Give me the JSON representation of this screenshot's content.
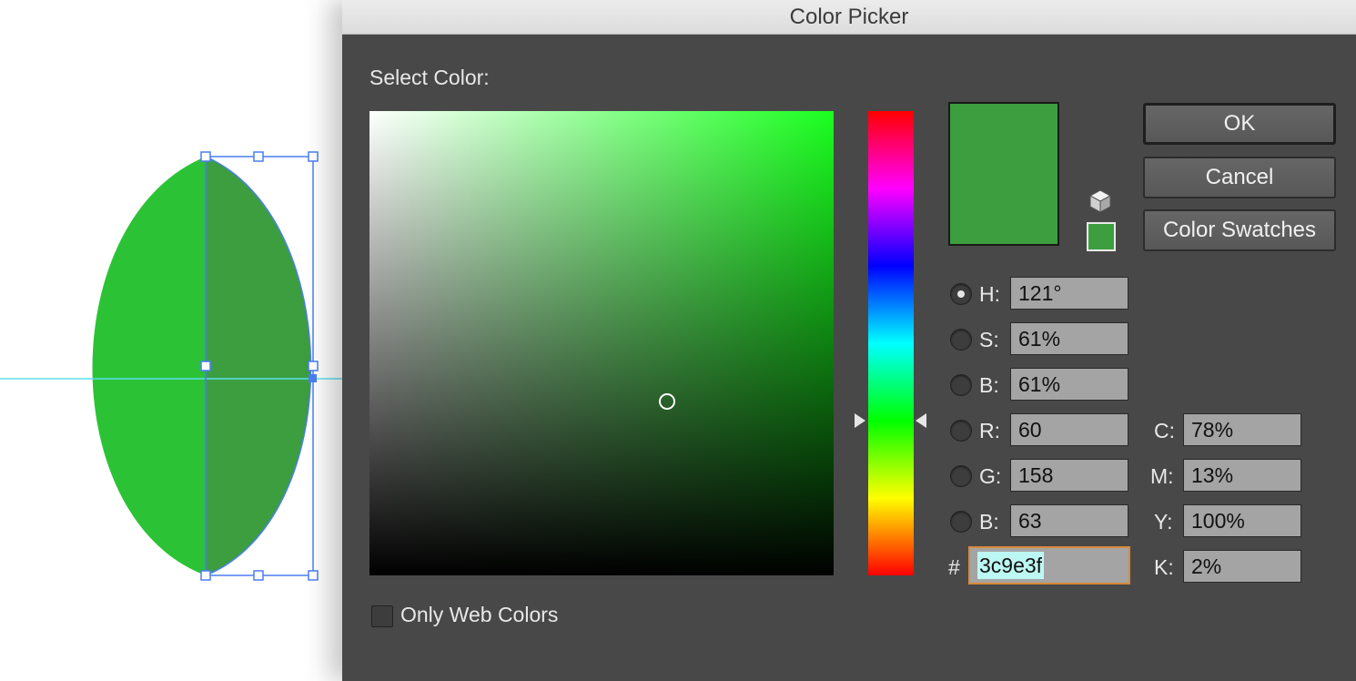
{
  "window": {
    "title": "Color Picker"
  },
  "select_label": "Select Color:",
  "current_color": "#3c9e3f",
  "fill_color_left": "#2bc335",
  "buttons": {
    "ok": "OK",
    "cancel": "Cancel",
    "swatches": "Color Swatches"
  },
  "hsb": [
    {
      "label": "H:",
      "value": "121°",
      "selected": true
    },
    {
      "label": "S:",
      "value": "61%",
      "selected": false
    },
    {
      "label": "B:",
      "value": "61%",
      "selected": false
    }
  ],
  "rgb": [
    {
      "label": "R:",
      "value": "60",
      "selected": false
    },
    {
      "label": "G:",
      "value": "158",
      "selected": false
    },
    {
      "label": "B:",
      "value": "63",
      "selected": false
    }
  ],
  "cmyk": [
    {
      "label": "C:",
      "value": "78%"
    },
    {
      "label": "M:",
      "value": "13%"
    },
    {
      "label": "Y:",
      "value": "100%"
    },
    {
      "label": "K:",
      "value": "2%"
    }
  ],
  "hex": {
    "label": "#",
    "value": "3c9e3f"
  },
  "web_only": {
    "label": "Only Web Colors",
    "checked": false
  },
  "icons": {
    "cube": "websafe-cube-icon"
  }
}
